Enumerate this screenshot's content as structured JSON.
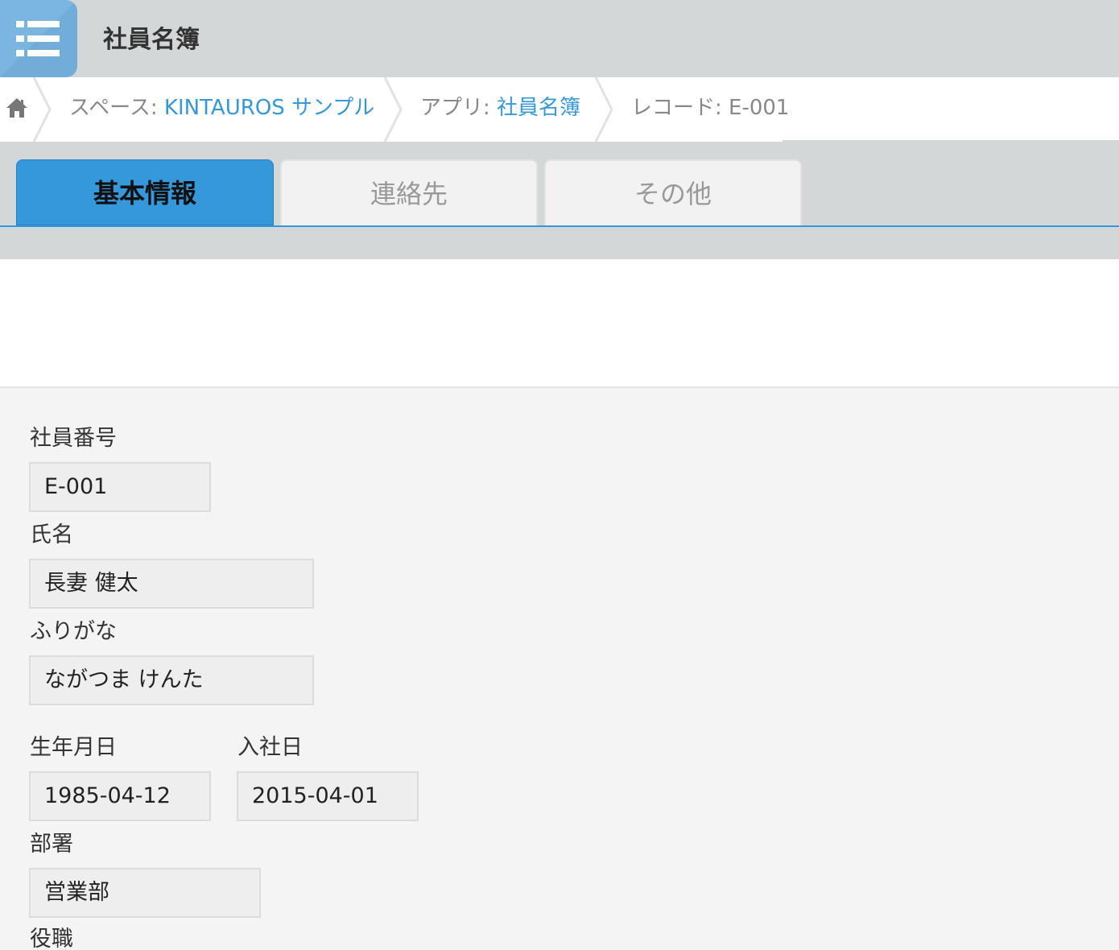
{
  "header": {
    "app_title": "社員名簿",
    "app_icon": "list-icon"
  },
  "breadcrumb": {
    "home_icon": "home-icon",
    "space_prefix": "スペース: ",
    "space_name": "KINTAUROS サンプル",
    "app_prefix": "アプリ: ",
    "app_name": "社員名簿",
    "record_label": "レコード: E-001"
  },
  "tabs": [
    {
      "label": "基本情報",
      "active": true
    },
    {
      "label": "連絡先",
      "active": false
    },
    {
      "label": "その他",
      "active": false
    }
  ],
  "form": {
    "employee_id": {
      "label": "社員番号",
      "value": "E-001"
    },
    "name": {
      "label": "氏名",
      "value": "長妻 健太"
    },
    "furigana": {
      "label": "ふりがな",
      "value": "ながつま けんた"
    },
    "birth_date": {
      "label": "生年月日",
      "value": "1985-04-12"
    },
    "join_date": {
      "label": "入社日",
      "value": "2015-04-01"
    },
    "department": {
      "label": "部署",
      "value": "営業部"
    },
    "position": {
      "label": "役職"
    }
  },
  "colors": {
    "accent": "#3498db",
    "header_bg": "#d4d7d8",
    "icon_bg": "#7bb6e2"
  }
}
